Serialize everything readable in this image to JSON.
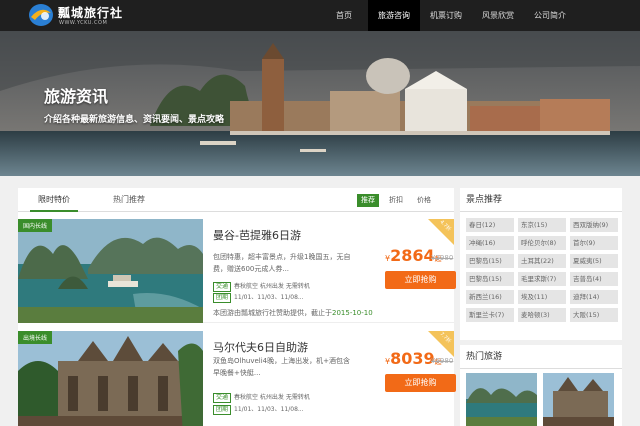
{
  "header": {
    "logo_text": "瓢城旅行社",
    "logo_sub": "WWW.YCKU.COM",
    "nav": [
      "首页",
      "旅游咨询",
      "机票订购",
      "风景欣赏",
      "公司简介"
    ],
    "active_nav": 1
  },
  "banner": {
    "title": "旅游资讯",
    "subtitle": "介绍各种最新旅游信息、资讯要闻、景点攻略"
  },
  "tabs": {
    "items": [
      "限时特价",
      "热门推荐"
    ],
    "sort": [
      "推荐",
      "折扣",
      "价格"
    ]
  },
  "cards": [
    {
      "tag": "国内长线",
      "title": "曼谷-芭提雅6日游",
      "desc": "包团特惠，超丰富景点，升级1晚国五，无自费，赠送600元成人券...",
      "transport_badge": "交通",
      "transport": "春秋航空 杭州出发 无需转机",
      "group_badge": "团期",
      "group": "11/01、11/03、11/08...",
      "yen": "¥",
      "price": "2864",
      "qi": "起",
      "old_price": "¥3980",
      "buy": "立即抢购",
      "corner": "4.7折",
      "sponsor": "本团游由瓢城旅行社赞助提供，截止于",
      "deadline": "2015-10-10"
    },
    {
      "tag": "出境长线",
      "title": "马尔代夫6日自助游",
      "desc": "双鱼岛Olhuveli4晚，上海出发，机+酒包含 早晚餐+快艇...",
      "transport_badge": "交通",
      "transport": "春秋航空 杭州出发 无需转机",
      "group_badge": "团期",
      "group": "11/01、11/03、11/08...",
      "yen": "¥",
      "price": "8039",
      "qi": "起",
      "old_price": "¥9980",
      "buy": "立即抢购",
      "corner": "7.7折"
    }
  ],
  "sidebar": {
    "scenic_title": "景点推荐",
    "scenic": [
      "春日(12)",
      "东京(15)",
      "西双版纳(9)",
      "冲绳(16)",
      "呼伦贝尔(8)",
      "首尔(9)",
      "巴黎岛(15)",
      "土耳其(22)",
      "夏威夷(5)",
      "巴黎岛(15)",
      "毛里求斯(7)",
      "吉普岛(4)",
      "新西兰(16)",
      "埃及(11)",
      "迪拜(14)",
      "斯里兰卡(7)",
      "麦哈顿(3)",
      "大阪(15)"
    ],
    "hot_title": "热门旅游"
  }
}
